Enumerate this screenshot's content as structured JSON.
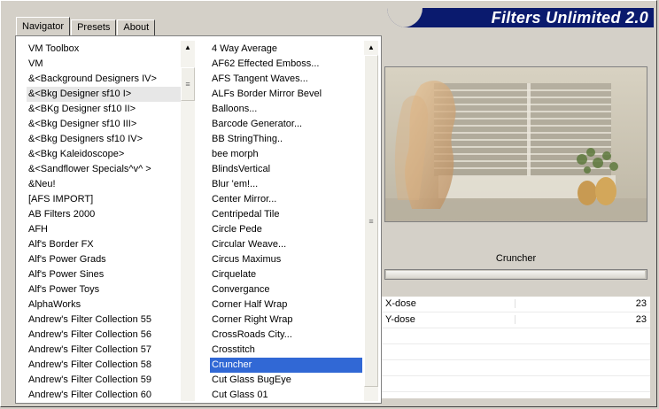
{
  "app": {
    "title": "Filters Unlimited 2.0"
  },
  "tabs": [
    {
      "label": "Navigator",
      "active": true
    },
    {
      "label": "Presets",
      "active": false
    },
    {
      "label": "About",
      "active": false
    }
  ],
  "categories": [
    "VM Toolbox",
    "VM",
    "&<Background Designers IV>",
    "&<Bkg Designer sf10 I>",
    "&<BKg Designer sf10 II>",
    "&<Bkg Designer sf10 III>",
    "&<Bkg Designers sf10 IV>",
    "&<Bkg Kaleidoscope>",
    "&<Sandflower Specials^v^ >",
    "&Neu!",
    "[AFS IMPORT]",
    "AB Filters 2000",
    "AFH",
    "Alf's Border FX",
    "Alf's Power Grads",
    "Alf's Power Sines",
    "Alf's Power Toys",
    "AlphaWorks",
    "Andrew's Filter Collection 55",
    "Andrew's Filter Collection 56",
    "Andrew's Filter Collection 57",
    "Andrew's Filter Collection 58",
    "Andrew's Filter Collection 59",
    "Andrew's Filter Collection 60"
  ],
  "categories_hover_index": 3,
  "filters": [
    "4 Way Average",
    "AF62 Effected Emboss...",
    "AFS Tangent Waves...",
    "ALFs Border Mirror Bevel",
    "Balloons...",
    "Barcode Generator...",
    "BB StringThing..",
    "bee morph",
    "BlindsVertical",
    "Blur 'em!...",
    "Center Mirror...",
    "Centripedal Tile",
    "Circle Pede",
    "Circular Weave...",
    "Circus Maximus",
    "Cirquelate",
    "Convergance",
    "Corner Half Wrap",
    "Corner Right Wrap",
    "CrossRoads City...",
    "Crosstitch",
    "Cruncher",
    "Cut Glass  BugEye",
    "Cut Glass 01"
  ],
  "filters_selected_index": 21,
  "preview": {
    "filter_name": "Cruncher"
  },
  "params": [
    {
      "label": "X-dose",
      "value": "23"
    },
    {
      "label": "Y-dose",
      "value": "23"
    }
  ],
  "colors": {
    "banner": "#0a1a6e",
    "selection": "#3168d5",
    "face": "#d4d0c8"
  }
}
